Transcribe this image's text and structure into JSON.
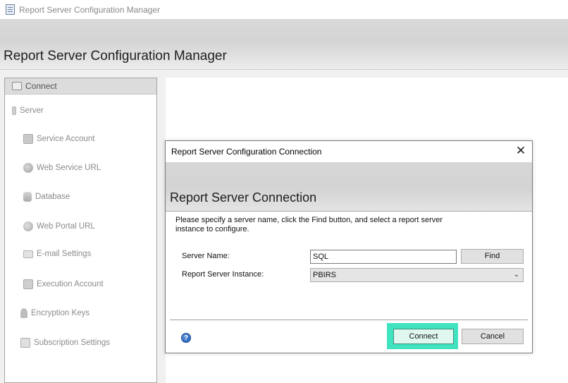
{
  "window": {
    "title": "Report Server Configuration Manager"
  },
  "header": {
    "heading": "Report Server Configuration Manager"
  },
  "sidebar": {
    "connect_label": "Connect",
    "server_label": "Server",
    "items": [
      {
        "label": "Service Account",
        "icon": "service-account-icon"
      },
      {
        "label": "Web Service URL",
        "icon": "web-service-url-icon"
      },
      {
        "label": "Database",
        "icon": "database-icon"
      },
      {
        "label": "Web Portal URL",
        "icon": "web-portal-url-icon"
      },
      {
        "label": "E-mail Settings",
        "icon": "email-settings-icon"
      },
      {
        "label": "Execution Account",
        "icon": "execution-account-icon"
      },
      {
        "label": "Encryption Keys",
        "icon": "encryption-keys-icon"
      },
      {
        "label": "Subscription Settings",
        "icon": "subscription-settings-icon"
      }
    ]
  },
  "dialog": {
    "title": "Report Server Configuration Connection",
    "close_glyph": "✕",
    "heading": "Report Server Connection",
    "description": "Please specify a server name, click the Find button, and select a report server instance to configure.",
    "server_name_label": "Server Name:",
    "server_name_value": "SQL",
    "find_label": "Find",
    "instance_label": "Report Server Instance:",
    "instance_value": "PBIRS",
    "help_glyph": "?",
    "connect_label": "Connect",
    "cancel_label": "Cancel"
  },
  "colors": {
    "highlight": "#3fe3c0",
    "header_gray": "#d6d6d6"
  }
}
